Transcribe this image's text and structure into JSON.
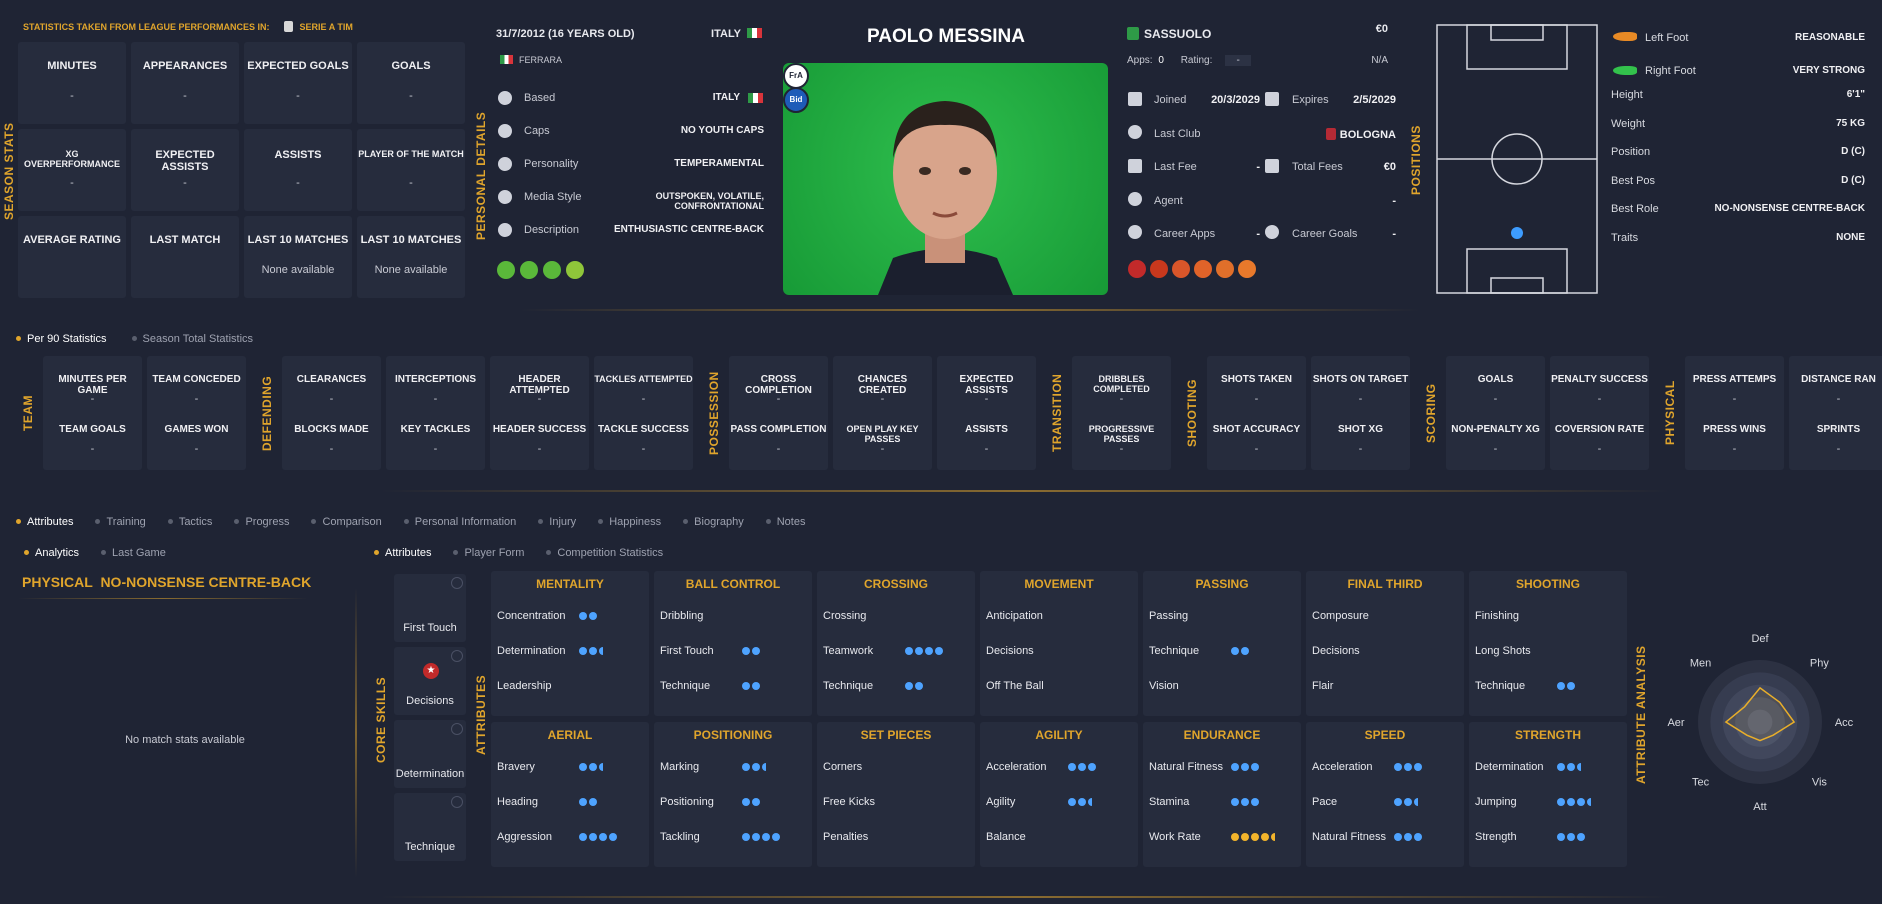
{
  "season": {
    "source_label": "STATISTICS TAKEN FROM LEAGUE PERFORMANCES IN:",
    "league": "SERIE A TIM",
    "side_label": "SEASON STATS",
    "tiles": [
      {
        "title": "MINUTES",
        "value": "-"
      },
      {
        "title": "APPEARANCES",
        "value": "-"
      },
      {
        "title": "EXPECTED GOALS",
        "value": "-"
      },
      {
        "title": "GOALS",
        "value": "-"
      },
      {
        "title": "XG OVERPERFORMANCE",
        "value": "-"
      },
      {
        "title": "EXPECTED ASSISTS",
        "value": "-"
      },
      {
        "title": "ASSISTS",
        "value": "-"
      },
      {
        "title": "PLAYER OF THE MATCH",
        "value": "-"
      },
      {
        "title": "AVERAGE RATING",
        "value": ""
      },
      {
        "title": "LAST MATCH",
        "value": ""
      },
      {
        "title": "LAST 10 MATCHES",
        "value": "None available"
      },
      {
        "title": "LAST 10 MATCHES",
        "value": "None available"
      }
    ]
  },
  "personal": {
    "side_label": "PERSONAL DETAILS",
    "dob": "31/7/2012 (16 YEARS OLD)",
    "nation": "ITALY",
    "birthplace": "FERRARA",
    "rows": [
      {
        "label": "Based",
        "value": "ITALY"
      },
      {
        "label": "Caps",
        "value": "NO YOUTH CAPS"
      },
      {
        "label": "Personality",
        "value": "TEMPERAMENTAL"
      },
      {
        "label": "Media Style",
        "value": "OUTSPOKEN, VOLATILE, CONFRONTATIONAL"
      },
      {
        "label": "Description",
        "value": "ENTHUSIASTIC CENTRE-BACK"
      }
    ]
  },
  "player": {
    "name": "PAOLO MESSINA",
    "badges": [
      "FrA",
      "Bid"
    ]
  },
  "contract": {
    "club": "SASSUOLO",
    "value": "€0",
    "apps_label": "Apps:",
    "apps": "0",
    "rating_label": "Rating:",
    "rating": "-",
    "na": "N/A",
    "joined_label": "Joined",
    "joined": "20/3/2029",
    "expires_label": "Expires",
    "expires": "2/5/2029",
    "last_club_label": "Last Club",
    "last_club": "BOLOGNA",
    "last_fee_label": "Last Fee",
    "last_fee": "-",
    "total_fees_label": "Total Fees",
    "total_fees": "€0",
    "agent_label": "Agent",
    "agent": "-",
    "career_apps_label": "Career Apps",
    "career_apps": "-",
    "career_goals_label": "Career Goals",
    "career_goals": "-"
  },
  "positions": {
    "side_label": "POSITIONS"
  },
  "physical": {
    "rows": [
      {
        "label": "Left Foot",
        "value": "REASONABLE"
      },
      {
        "label": "Right Foot",
        "value": "VERY STRONG"
      },
      {
        "label": "Height",
        "value": "6'1\""
      },
      {
        "label": "Weight",
        "value": "75 KG"
      },
      {
        "label": "Position",
        "value": "D (C)"
      },
      {
        "label": "Best Pos",
        "value": "D (C)"
      },
      {
        "label": "Best Role",
        "value": "NO-NONSENSE CENTRE-BACK"
      },
      {
        "label": "Traits",
        "value": "NONE"
      }
    ]
  },
  "stats_tabs": [
    "Per 90 Statistics",
    "Season Total Statistics"
  ],
  "stat_groups": [
    {
      "label": "TEAM",
      "cols": [
        [
          "MINUTES PER GAME",
          "-",
          "TEAM GOALS",
          "-"
        ],
        [
          "TEAM CONCEDED",
          "-",
          "GAMES WON",
          "-"
        ]
      ]
    },
    {
      "label": "DEFENDING",
      "cols": [
        [
          "CLEARANCES",
          "-",
          "BLOCKS MADE",
          "-"
        ],
        [
          "INTERCEPTIONS",
          "-",
          "KEY TACKLES",
          "-"
        ],
        [
          "HEADER ATTEMPTED",
          "-",
          "HEADER SUCCESS",
          "-"
        ],
        [
          "TACKLES ATTEMPTED",
          "-",
          "TACKLE SUCCESS",
          "-"
        ]
      ]
    },
    {
      "label": "POSSESSION",
      "cols": [
        [
          "CROSS COMPLETION",
          "-",
          "PASS COMPLETION",
          "-"
        ],
        [
          "CHANCES CREATED",
          "-",
          "OPEN PLAY KEY PASSES",
          "-"
        ],
        [
          "EXPECTED ASSISTS",
          "-",
          "ASSISTS",
          "-"
        ]
      ]
    },
    {
      "label": "TRANSITION",
      "cols": [
        [
          "DRIBBLES COMPLETED",
          "-",
          "PROGRESSIVE PASSES",
          "-"
        ]
      ]
    },
    {
      "label": "SHOOTING",
      "cols": [
        [
          "SHOTS TAKEN",
          "-",
          "SHOT ACCURACY",
          "-"
        ],
        [
          "SHOTS ON TARGET",
          "-",
          "SHOT XG",
          "-"
        ]
      ]
    },
    {
      "label": "SCORING",
      "cols": [
        [
          "GOALS",
          "-",
          "NON-PENALTY XG",
          "-"
        ],
        [
          "PENALTY SUCCESS",
          "-",
          "COVERSION RATE",
          "-"
        ]
      ]
    },
    {
      "label": "PHYSICAL",
      "cols": [
        [
          "PRESS ATTEMPS",
          "-",
          "PRESS WINS",
          "-"
        ],
        [
          "DISTANCE RAN",
          "-",
          "SPRINTS",
          "-"
        ]
      ]
    }
  ],
  "main_tabs": [
    "Attributes",
    "Training",
    "Tactics",
    "Progress",
    "Comparison",
    "Personal Information",
    "Injury",
    "Happiness",
    "Biography",
    "Notes"
  ],
  "left_tabs": [
    "Analytics",
    "Last Game"
  ],
  "analytics": {
    "title_a": "PHYSICAL",
    "title_b": "NO-NONSENSE CENTRE-BACK",
    "empty": "No match stats available"
  },
  "attr_tabs": [
    "Attributes",
    "Player Form",
    "Competition Statistics"
  ],
  "core_skills": {
    "side_label": "CORE SKILLS",
    "items": [
      "First Touch",
      "Decisions",
      "Determination",
      "Technique"
    ]
  },
  "attributes_label": "ATTRIBUTES",
  "attr_boxes": [
    {
      "title": "MENTALITY",
      "rows": [
        [
          "Concentration",
          2,
          0,
          0
        ],
        [
          "Determination",
          2,
          1,
          0
        ],
        [
          "Leadership",
          0,
          0,
          0
        ]
      ]
    },
    {
      "title": "BALL CONTROL",
      "rows": [
        [
          "Dribbling",
          0,
          0,
          0
        ],
        [
          "First Touch",
          2,
          0,
          0
        ],
        [
          "Technique",
          2,
          0,
          0
        ]
      ]
    },
    {
      "title": "CROSSING",
      "rows": [
        [
          "Crossing",
          0,
          0,
          0
        ],
        [
          "Teamwork",
          4,
          0,
          0
        ],
        [
          "Technique",
          2,
          0,
          0
        ]
      ]
    },
    {
      "title": "MOVEMENT",
      "rows": [
        [
          "Anticipation",
          0,
          0,
          0
        ],
        [
          "Decisions",
          0,
          0,
          0
        ],
        [
          "Off The Ball",
          0,
          0,
          0
        ]
      ]
    },
    {
      "title": "PASSING",
      "rows": [
        [
          "Passing",
          0,
          0,
          0
        ],
        [
          "Technique",
          2,
          0,
          0
        ],
        [
          "Vision",
          0,
          0,
          0
        ]
      ]
    },
    {
      "title": "FINAL THIRD",
      "rows": [
        [
          "Composure",
          0,
          0,
          0
        ],
        [
          "Decisions",
          0,
          0,
          0
        ],
        [
          "Flair",
          0,
          0,
          0
        ]
      ]
    },
    {
      "title": "SHOOTING",
      "rows": [
        [
          "Finishing",
          0,
          0,
          0
        ],
        [
          "Long Shots",
          0,
          0,
          0
        ],
        [
          "Technique",
          2,
          0,
          0
        ]
      ]
    },
    {
      "title": "AERIAL",
      "rows": [
        [
          "Bravery",
          2,
          1,
          0
        ],
        [
          "Heading",
          2,
          0,
          0
        ],
        [
          "Aggression",
          4,
          0,
          0
        ]
      ]
    },
    {
      "title": "POSITIONING",
      "rows": [
        [
          "Marking",
          2,
          1,
          0
        ],
        [
          "Positioning",
          2,
          0,
          0
        ],
        [
          "Tackling",
          4,
          0,
          0
        ]
      ]
    },
    {
      "title": "SET PIECES",
      "rows": [
        [
          "Corners",
          0,
          0,
          0
        ],
        [
          "Free Kicks",
          0,
          0,
          0
        ],
        [
          "Penalties",
          0,
          0,
          0
        ]
      ]
    },
    {
      "title": "AGILITY",
      "rows": [
        [
          "Acceleration",
          3,
          0,
          0
        ],
        [
          "Agility",
          2,
          1,
          0
        ],
        [
          "Balance",
          0,
          0,
          0
        ]
      ]
    },
    {
      "title": "ENDURANCE",
      "rows": [
        [
          "Natural Fitness",
          3,
          0,
          0
        ],
        [
          "Stamina",
          3,
          0,
          0
        ],
        [
          "Work Rate",
          4,
          1,
          1
        ]
      ]
    },
    {
      "title": "SPEED",
      "rows": [
        [
          "Acceleration",
          3,
          0,
          0
        ],
        [
          "Pace",
          2,
          1,
          0
        ],
        [
          "Natural Fitness",
          3,
          0,
          0
        ]
      ]
    },
    {
      "title": "STRENGTH",
      "rows": [
        [
          "Determination",
          2,
          1,
          0
        ],
        [
          "Jumping",
          3,
          1,
          0
        ],
        [
          "Strength",
          3,
          0,
          0
        ]
      ]
    }
  ],
  "radar": {
    "side_label": "ATTRIBUTE ANALYSIS",
    "axes": [
      "Def",
      "Phy",
      "Acc",
      "Vis",
      "Att",
      "Tec",
      "Aer",
      "Men"
    ],
    "values": [
      0.55,
      0.45,
      0.55,
      0.3,
      0.3,
      0.3,
      0.55,
      0.35
    ]
  }
}
